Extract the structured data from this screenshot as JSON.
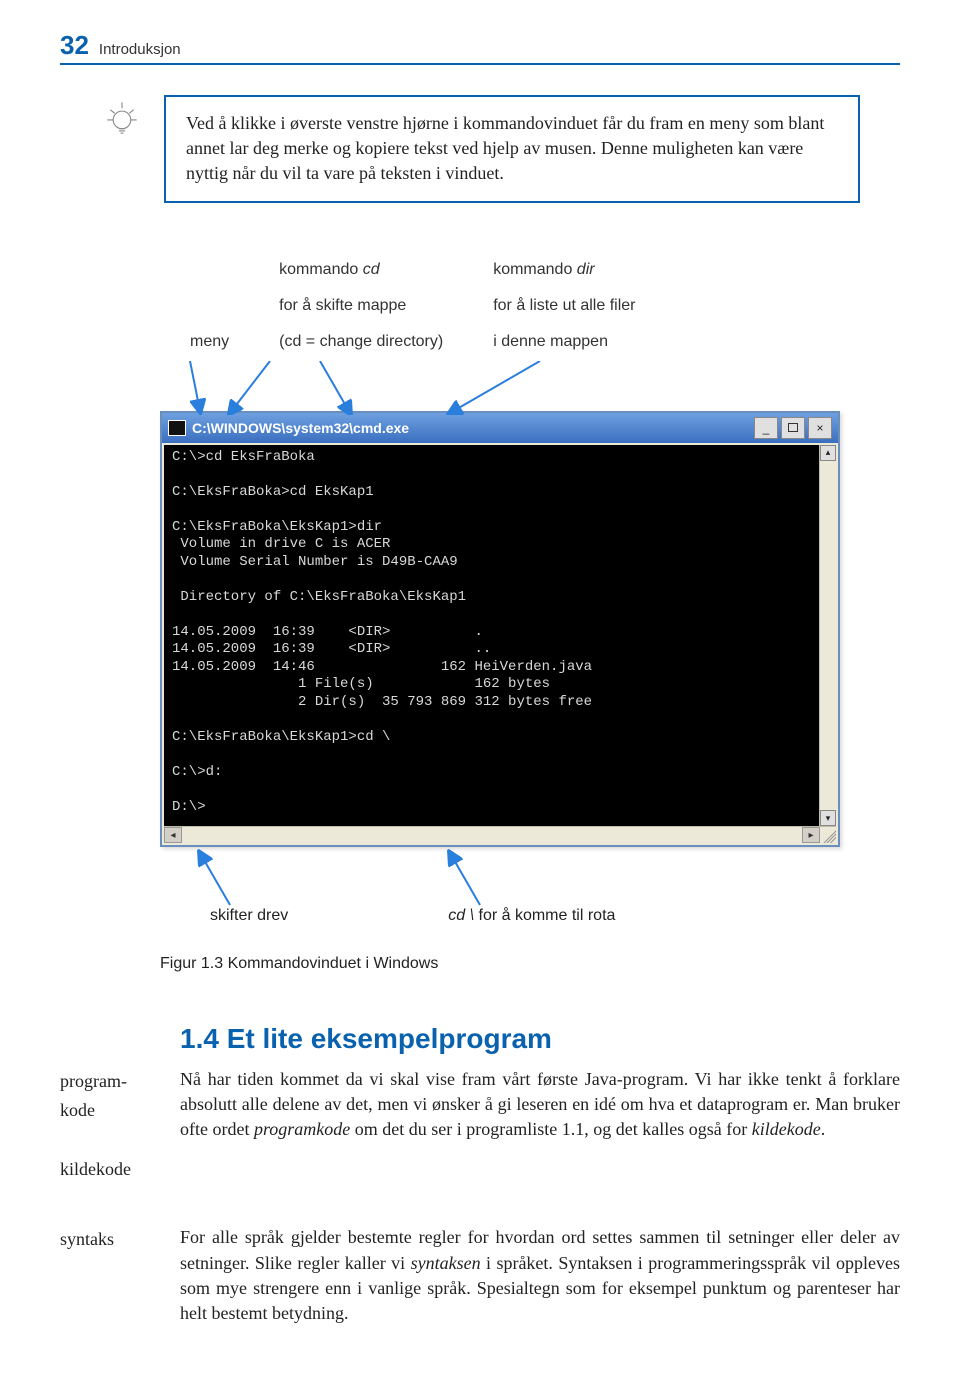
{
  "header": {
    "page_number": "32",
    "chapter": "Introduksjon"
  },
  "tip": {
    "text": "Ved å klikke i øverste venstre hjørne i kommandovinduet får du fram en meny som blant annet lar deg merke og kopiere tekst ved hjelp av musen. Denne muligheten kan være nyttig når du vil ta vare på teksten i vinduet."
  },
  "annotations_top": {
    "meny": "meny",
    "cd_label_pre": "kommando ",
    "cd_cmd": "cd",
    "cd_line2": "for å skifte mappe",
    "cd_line3": "(cd = change directory)",
    "dir_label_pre": "kommando ",
    "dir_cmd": "dir",
    "dir_line2": "for å liste ut alle filer",
    "dir_line3": "i denne mappen"
  },
  "cmd_window": {
    "title": "C:\\WINDOWS\\system32\\cmd.exe",
    "lines": "C:\\>cd EksFraBoka\n\nC:\\EksFraBoka>cd EksKap1\n\nC:\\EksFraBoka\\EksKap1>dir\n Volume in drive C is ACER\n Volume Serial Number is D49B-CAA9\n\n Directory of C:\\EksFraBoka\\EksKap1\n\n14.05.2009  16:39    <DIR>          .\n14.05.2009  16:39    <DIR>          ..\n14.05.2009  14:46               162 HeiVerden.java\n               1 File(s)            162 bytes\n               2 Dir(s)  35 793 869 312 bytes free\n\nC:\\EksFraBoka\\EksKap1>cd \\\n\nC:\\>d:\n\nD:\\>"
  },
  "annotations_bottom": {
    "drev": "skifter drev",
    "rota_cmd": "cd \\",
    "rota_rest": " for å komme til rota"
  },
  "figure_caption": "Figur 1.3  Kommandovinduet i Windows",
  "section": {
    "heading": "1.4  Et lite eksempelprogram",
    "margin_notes": {
      "n1": "program-kode",
      "n2": "kildekode",
      "n3": "syntaks"
    },
    "para1_a": "Nå har tiden kommet da vi skal vise fram vårt første Java-program. Vi har ikke tenkt å forklare absolutt alle delene av det, men vi ønsker å gi leseren en idé om hva et dataprogram er. Man bruker ofte ordet ",
    "para1_em1": "programkode",
    "para1_b": " om det du ser i programliste 1.1, og det kalles også for ",
    "para1_em2": "kildekode",
    "para1_c": ".",
    "para2_a": "For alle språk gjelder bestemte regler for hvordan ord settes sammen til setninger eller deler av setninger. Slike regler kaller vi ",
    "para2_em1": "syntaksen",
    "para2_b": " i språket. Syntaksen i programmeringsspråk vil oppleves som mye strengere enn i vanlige språk. Spesialtegn som for eksempel punktum og parenteser har helt bestemt betydning."
  }
}
